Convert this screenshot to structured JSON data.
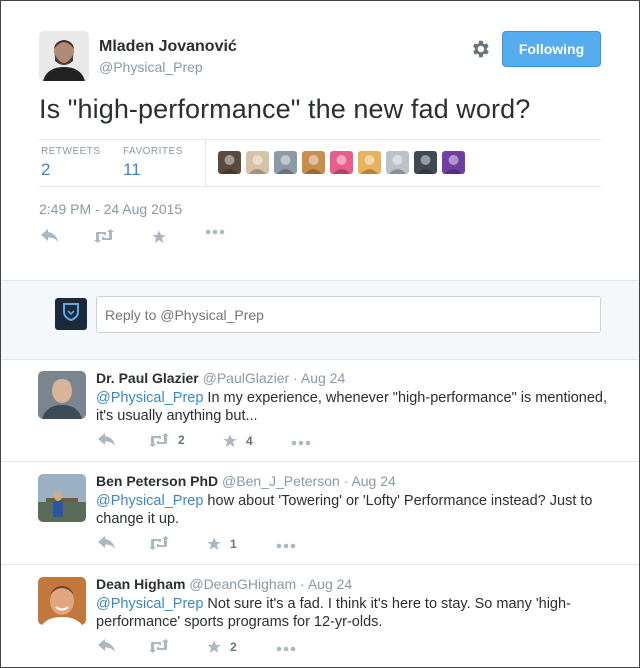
{
  "tweet": {
    "author_name": "Mladen Jovanović",
    "author_handle": "@Physical_Prep",
    "follow_label": "Following",
    "text": "Is \"high-performance\" the new fad word?",
    "stats": {
      "retweets_label": "RETWEETS",
      "retweets": "2",
      "favorites_label": "FAVORITES",
      "favorites": "11"
    },
    "timestamp": "2:49 PM - 24 Aug 2015",
    "favoriters": [
      "#5b4b3f",
      "#d8c2a7",
      "#8c9aa5",
      "#c98d4e",
      "#e85d8d",
      "#e6b25c",
      "#b9c2c8",
      "#3f4a55",
      "#6f3fa3"
    ]
  },
  "reply_box": {
    "placeholder": "Reply to @Physical_Prep"
  },
  "replies": [
    {
      "name": "Dr. Paul Glazier",
      "handle": "@PaulGlazier",
      "sep": " · ",
      "date": "Aug 24",
      "mention": "@Physical_Prep",
      "text": " In my experience, whenever \"high-performance\" is mentioned, it's usually anything but...",
      "retweets": "2",
      "favorites": "4"
    },
    {
      "name": "Ben Peterson PhD",
      "handle": "@Ben_J_Peterson",
      "sep": " · ",
      "date": "Aug 24",
      "mention": "@Physical_Prep",
      "text": " how about 'Towering' or 'Lofty' Performance instead? Just to change it up.",
      "retweets": "",
      "favorites": "1"
    },
    {
      "name": "Dean Higham",
      "handle": "@DeanGHigham",
      "sep": " · ",
      "date": "Aug 24",
      "mention": "@Physical_Prep",
      "text": " Not sure it's a fad. I think it's here to stay. So many 'high-performance' sports programs for 12-yr-olds.",
      "retweets": "",
      "favorites": "2"
    }
  ],
  "colors": {
    "accent": "#55acee",
    "link": "#3b88c3",
    "muted": "#8899a6",
    "icon": "#aab8c2"
  },
  "icons": [
    "reply-icon",
    "retweet-icon",
    "favorite-star-icon",
    "more-dots-icon",
    "gear-icon",
    "shield-logo-icon"
  ]
}
